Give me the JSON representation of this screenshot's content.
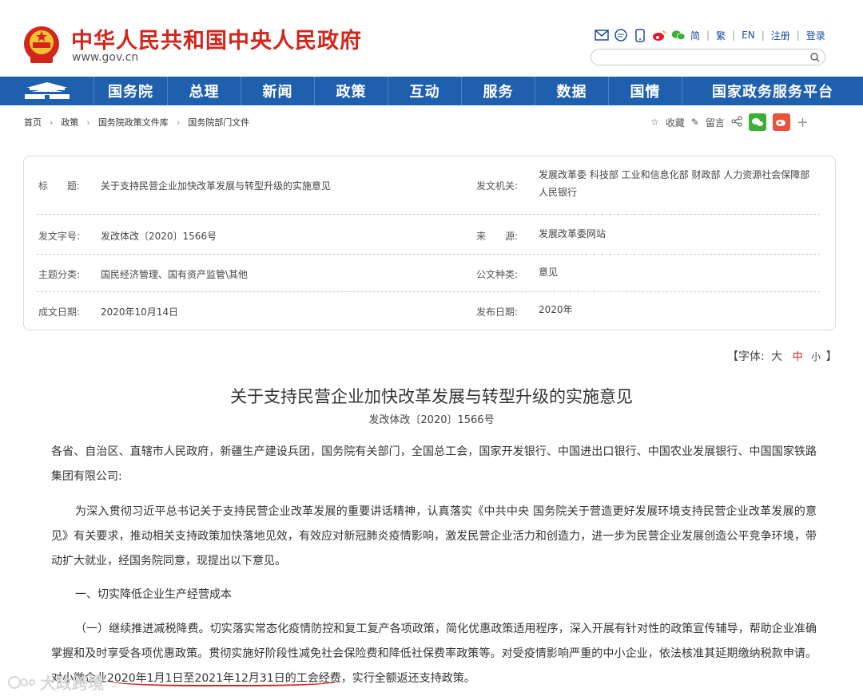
{
  "header": {
    "title": "中华人民共和国中央人民政府",
    "url": "www.gov.cn",
    "links": [
      "简",
      "繁",
      "EN",
      "注册",
      "登录"
    ],
    "search_placeholder": ""
  },
  "nav": {
    "items": [
      "国务院",
      "总理",
      "新闻",
      "政策",
      "互动",
      "服务",
      "数据",
      "国情",
      "国家政务服务平台"
    ]
  },
  "breadcrumb": [
    "首页",
    "政策",
    "国务院政策文件库",
    "国务院部门文件"
  ],
  "tools": {
    "favorite": "收藏",
    "comment": "留言"
  },
  "info": {
    "title_label": "标　　题:",
    "title_value": "关于支持民营企业加快改革发展与转型升级的实施意见",
    "issuer_label": "发文机关:",
    "issuer_value": "发展改革委  科技部  工业和信息化部  财政部  人力资源社会保障部  人民银行",
    "docno_label": "发文字号:",
    "docno_value": "发改体改〔2020〕1566号",
    "source_label": "来　　源:",
    "source_value": "发展改革委网站",
    "topic_label": "主题分类:",
    "topic_value": "国民经济管理、国有资产监管\\其他",
    "type_label": "公文种类:",
    "type_value": "意见",
    "date_label": "成文日期:",
    "date_value": "2020年10月14日",
    "pubdate_label": "发布日期:",
    "pubdate_value": "2020年"
  },
  "fontsize": {
    "prefix": "【字体:",
    "large": "大",
    "medium": "中",
    "small": "小",
    "suffix": "】"
  },
  "article": {
    "title": "关于支持民营企业加快改革发展与转型升级的实施意见",
    "doc_no": "发改体改〔2020〕1566号",
    "p1": "各省、自治区、直辖市人民政府，新疆生产建设兵团，国务院有关部门，全国总工会，国家开发银行、中国进出口银行、中国农业发展银行、中国国家铁路集团有限公司:",
    "p2": "为深入贯彻习近平总书记关于支持民营企业改革发展的重要讲话精神，认真落实《中共中央 国务院关于营造更好发展环境支持民营企业改革发展的意见》有关要求，推动相关支持政策加快落地见效，有效应对新冠肺炎疫情影响，激发民营企业活力和创造力，进一步为民营企业发展创造公平竞争环境，带动扩大就业，经国务院同意，现提出以下意见。",
    "h1": "一、切实降低企业生产经营成本",
    "p3_a": "（一）继续推进减税降费。切实落实常态化疫情防控和复工复产各项政策，简化优惠政策适用程序，深入开展有针对性的政策宣传辅导，帮助企业准确掌握和及时享受各项优惠政策。贯彻实施好阶段性减免社会保险费和降低社保费率政策等。对受疫情影响严重的中小企业，依法核准其延期缴纳税款申请。对小微企业",
    "p3_hl": "2020年1月1日至2021年12月31日的工会经费",
    "p3_b": "，实行全额返还支持政策。"
  },
  "watermark": "大政跨境"
}
